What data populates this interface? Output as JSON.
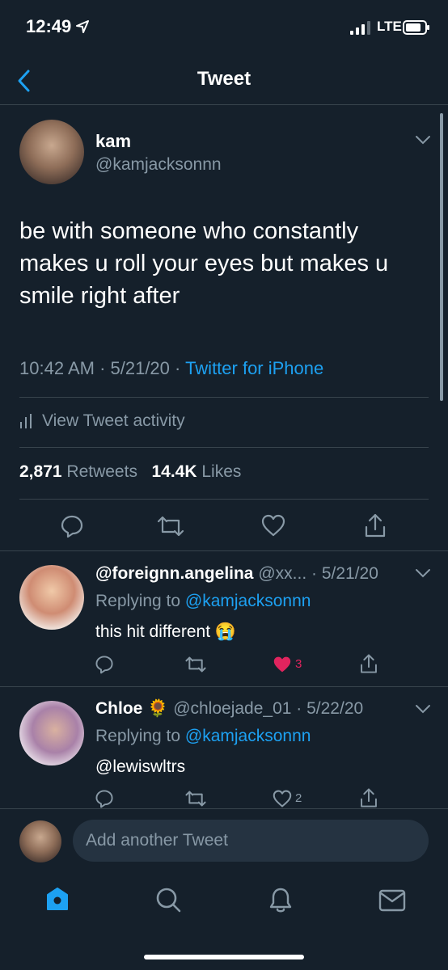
{
  "status_bar": {
    "time": "12:49",
    "network": "LTE"
  },
  "nav": {
    "title": "Tweet"
  },
  "tweet": {
    "author_name": "kam",
    "author_handle": "@kamjacksonnn",
    "text_lines": [
      "be with someone who constantly",
      "makes u roll your eyes but makes u",
      "smile right after"
    ],
    "time_date": "10:42 AM · 5/21/20 ·",
    "source": "Twitter for iPhone",
    "activity_label": "View Tweet activity",
    "retweets_count": "2,871",
    "retweets_label": "Retweets",
    "likes_count": "14.4K",
    "likes_label": "Likes"
  },
  "replies": [
    {
      "name": "@foreignn.angelina",
      "handle_date": "@xx... · 5/21/20",
      "replying_prefix": "Replying to",
      "replying_to": "@kamjacksonnn",
      "text": "this hit different",
      "emoji": "😭",
      "like_count": "3",
      "liked": true
    },
    {
      "name": "Chloe",
      "emoji_name": "🌻",
      "handle_date": "@chloejade_01 · 5/22/20",
      "replying_prefix": "Replying to",
      "replying_to": "@kamjacksonnn",
      "text": "@lewiswltrs",
      "like_count": "2",
      "liked": false
    }
  ],
  "compose": {
    "placeholder": "Add another Tweet"
  },
  "tabs": [
    "home-icon",
    "search-icon",
    "notifications-icon",
    "messages-icon"
  ],
  "colors": {
    "background": "#15202b",
    "accent": "#1da1f2",
    "muted": "#8899a6",
    "like": "#e0245e",
    "divider": "#38444d"
  }
}
